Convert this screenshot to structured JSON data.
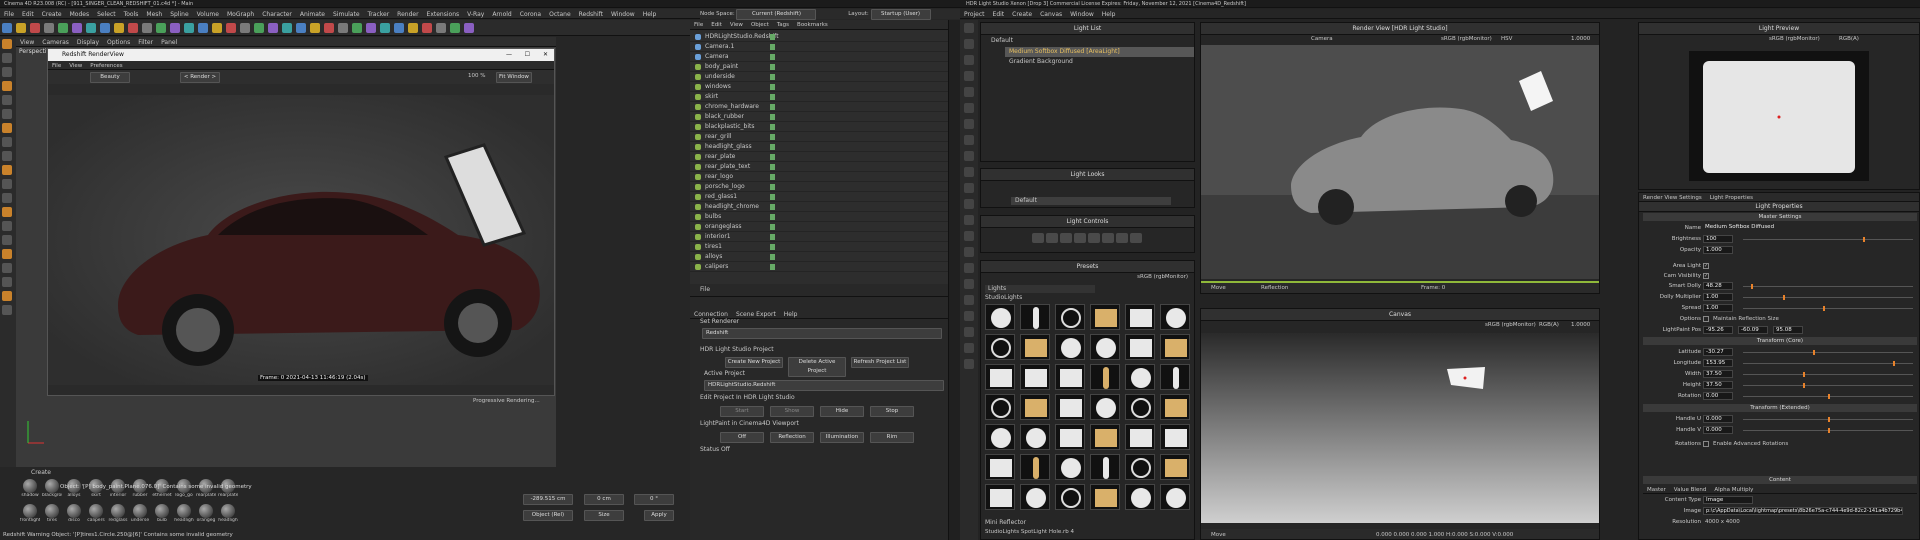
{
  "c4d": {
    "title": "Cinema 4D R23.008 (RC) - [911_SINGER_CLEAN_REDSHIFT_01.c4d *] - Main",
    "menu": [
      "File",
      "Edit",
      "Create",
      "Modes",
      "Select",
      "Tools",
      "Mesh",
      "Spline",
      "Volume",
      "MoGraph",
      "Character",
      "Animate",
      "Simulate",
      "Tracker",
      "Render",
      "Extensions",
      "V-Ray",
      "Arnold",
      "Corona",
      "Octane",
      "Redshift",
      "Window",
      "Help"
    ],
    "node_space_label": "Node Space:",
    "node_space_value": "Current (Redshift)",
    "layout_label": "Layout:",
    "layout_value": "Startup (User)",
    "viewport_menu": [
      "View",
      "Cameras",
      "Display",
      "Options",
      "Filter",
      "Panel"
    ],
    "viewport_label": "Perspective",
    "render_view": {
      "title": "Redshift RenderView",
      "menu": [
        "File",
        "View",
        "Preferences"
      ],
      "aov": "Beauty",
      "render_btn": "< Render >",
      "zoom": "100 %",
      "fit": "Fit Window",
      "frame_info": "Frame: 0  2021-04-13 11:46:19 (2.04s)"
    },
    "object_menu": [
      "File",
      "Edit",
      "View",
      "Object",
      "Tags",
      "Bookmarks"
    ],
    "objects": [
      "HDRLightStudio.Redshift",
      "Camera.1",
      "Camera",
      "body_paint",
      "underside",
      "windows",
      "skirt",
      "chrome_hardware",
      "black_rubber",
      "blackplastic_bits",
      "rear_grill",
      "headlight_glass",
      "rear_plate",
      "rear_plate_text",
      "rear_logo",
      "porsche_logo",
      "red_glass1",
      "headlight_chrome",
      "bulbs",
      "orangeglass",
      "interior1",
      "tires1",
      "alloys",
      "calipers"
    ],
    "attr_file": "File",
    "attr_tabs": [
      "Connection",
      "Scene Export",
      "Help"
    ],
    "attr": {
      "set_renderer": "Set Renderer",
      "renderer": "Redshift",
      "project_hdr": "HDR Light Studio Project",
      "btn_create": "Create New Project",
      "btn_delete": "Delete Active Project",
      "btn_refresh": "Refresh Project List",
      "active_project": "Active Project",
      "active_value": "HDRLightStudio.Redshift",
      "edit_project": "Edit Project In HDR Light Studio",
      "btn_start": "Start",
      "btn_show": "Show",
      "btn_hide": "Hide",
      "btn_stop": "Stop",
      "lightpaint": "LightPaint in Cinema4D Viewport",
      "btn_off": "Off",
      "btn_reflection": "Reflection",
      "btn_illumination": "Illumination",
      "btn_rim": "Rim",
      "status": "Status Off"
    },
    "progressive": "Progressive Rendering...",
    "status_object": "Object: '[P] body_paint.Plane.076.0]' Contains some invalid geometry",
    "status_bottom": "Redshift Warning Object: '[P]tires1.Circle.250@[6]' Contains some invalid geometry",
    "material_create": "Create",
    "materials": [
      "shadow",
      "blackgrou",
      "alloys",
      "skirt",
      "interior",
      "rubber",
      "ethernet",
      "logo_go",
      "rearplate",
      "rearplate",
      "frontlight",
      "tires",
      "disco",
      "calipers",
      "redglass",
      "underse",
      "bulb",
      "headligh",
      "orangeg",
      "headligh"
    ],
    "coord": {
      "pos": "-289.515 cm",
      "size": "0 cm",
      "rot": "0 °",
      "mode": "Object (Rel)",
      "size_mode": "Size",
      "apply": "Apply"
    }
  },
  "hdr": {
    "title": "HDR Light Studio Xenon [Drop 3] Commercial License Expires: Friday, November 12, 2021 [Cinema4D_Redshift]",
    "menu": [
      "Project",
      "Edit",
      "Create",
      "Canvas",
      "Window",
      "Help"
    ],
    "light_list_title": "Light List",
    "default_label": "Default",
    "lights": [
      "Medium Softbox Diffused [AreaLight]",
      "Gradient Background"
    ],
    "light_looks_title": "Light Looks",
    "looks_default": "Default",
    "light_controls_title": "Light Controls",
    "presets_title": "Presets",
    "presets_colorspace": "sRGB (rgbMonitor)",
    "presets_cat": "Lights",
    "presets_sub": "StudioLights",
    "preset_selected": "Mini Reflector",
    "preset_footer": "StudioLights SpotLight Hole.rb 4",
    "render_view_title": "Render View [HDR Light Studio]",
    "render_cam": "Camera",
    "render_cs": "sRGB (rgbMonitor)",
    "render_mode": "HSV",
    "render_val": "1.0000",
    "move": "Move",
    "reflection": "Reflection",
    "frame": "Frame: 0",
    "canvas_title": "Canvas",
    "canvas_cs": "sRGB (rgbMonitor)",
    "canvas_mode": "RGB(A)",
    "canvas_val": "1.0000",
    "canvas_status": "0.000  0.000  0.000  1.000     H:0.000 S:0.000 V:0.000",
    "light_preview_title": "Light Preview",
    "lp_cs": "sRGB (rgbMonitor)",
    "lp_mode": "RGB(A)",
    "props_tabs": [
      "Render View Settings",
      "Light Properties"
    ],
    "props_title": "Light Properties",
    "master_settings": "Master Settings",
    "name_label": "Name",
    "name_value": "Medium Softbox Diffused",
    "brightness_label": "Brightness",
    "brightness": "100",
    "opacity_label": "Opacity",
    "opacity": "1.000",
    "area_light": "Area Light",
    "cam_visibility": "Cam Visibility",
    "smart_dolly_label": "Smart Dolly",
    "smart_dolly": "48.28",
    "dolly_mult_label": "Dolly Multiplier",
    "dolly_mult": "1.00",
    "spread_label": "Spread",
    "spread": "1.00",
    "options_label": "Options",
    "maintain": "Maintain Reflection Size",
    "lp_pos_label": "LightPaint Pos",
    "lp_pos": [
      "-95.26",
      "-60.09",
      "95.08"
    ],
    "transform_core": "Transform (Core)",
    "latitude_label": "Latitude",
    "latitude": "-30.27",
    "longitude_label": "Longitude",
    "longitude": "153.95",
    "width_label": "Width",
    "width": "37.50",
    "height_label": "Height",
    "height": "37.50",
    "rotation_label": "Rotation",
    "rotation": "0.00",
    "transform_ext": "Transform (Extended)",
    "handle_u_label": "Handle U",
    "handle_u": "0.000",
    "handle_v_label": "Handle V",
    "handle_v": "0.000",
    "rotations_label": "Rotations",
    "enable_adv": "Enable Advanced Rotations",
    "content_title": "Content",
    "content_tabs": [
      "Master",
      "Value Blend",
      "Alpha Multiply"
    ],
    "content_type_label": "Content Type",
    "content_type": "Image",
    "image_label": "Image",
    "image_path": "p:\\c\\AppData\\Local\\lightmap\\presets\\8b26e75a-c744-4e9d-82c2-141a4b729b4a.tx",
    "resolution_label": "Resolution",
    "resolution": "4000 x 4000"
  }
}
